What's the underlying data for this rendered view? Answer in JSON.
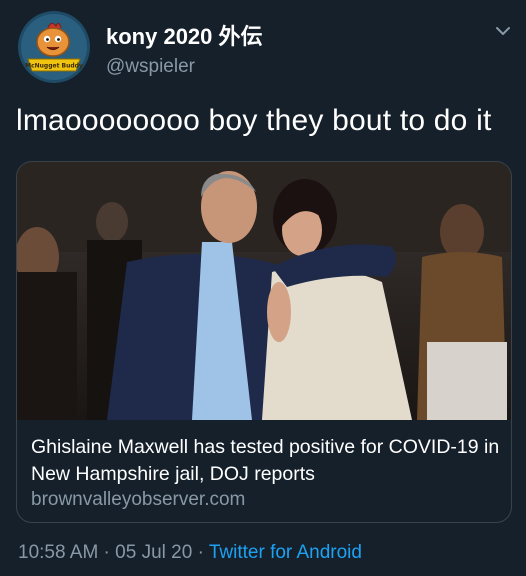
{
  "author": {
    "display_name": "kony 2020 外伝",
    "handle": "@wspieler",
    "avatar_badge_text": "McNugget Buddy"
  },
  "tweet": {
    "text": "lmaoooooooo boy they bout to do it"
  },
  "card": {
    "headline": "Ghislaine Maxwell has tested positive for COVID-19 in New Hampshire jail, DOJ reports",
    "domain": "brownvalleyobserver.com"
  },
  "meta": {
    "time": "10:58 AM",
    "separator": " · ",
    "date": "05 Jul 20",
    "source": "Twitter for Android"
  },
  "icons": {
    "menu": "chevron-down-icon"
  },
  "colors": {
    "background": "#15202b",
    "secondary_text": "#8899a6",
    "link": "#1da1f2",
    "card_border": "#38444d"
  }
}
